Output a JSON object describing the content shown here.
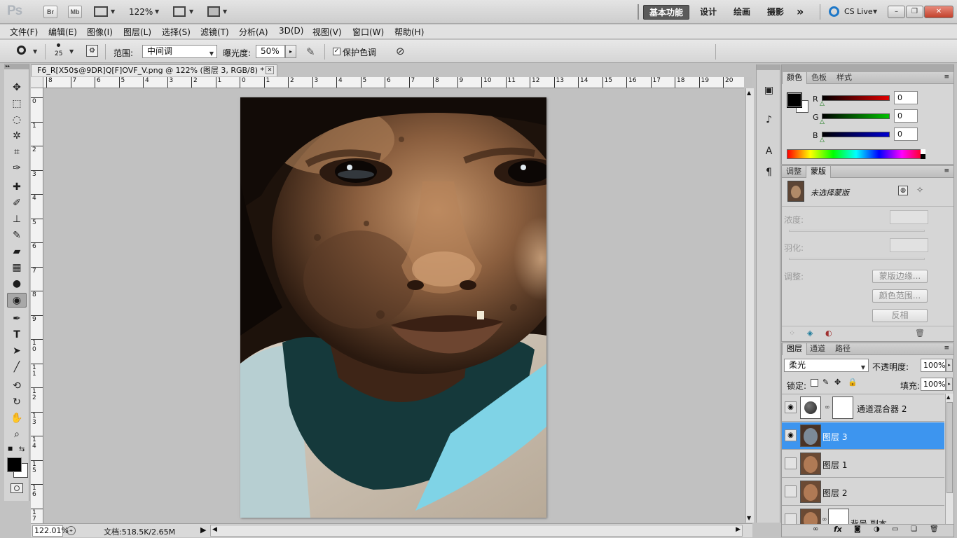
{
  "appbar": {
    "logo": "Ps",
    "bridge_btn": "Br",
    "minibridge_btn": "Mb",
    "zoom": "122%",
    "workspaces": [
      "基本功能",
      "设计",
      "绘画",
      "摄影"
    ],
    "more": "»",
    "cs_live": "CS Live",
    "window_controls": {
      "minimize": "–",
      "restore": "❐",
      "close": "✕"
    }
  },
  "menu": [
    "文件(F)",
    "编辑(E)",
    "图像(I)",
    "图层(L)",
    "选择(S)",
    "滤镜(T)",
    "分析(A)",
    "3D(D)",
    "视图(V)",
    "窗口(W)",
    "帮助(H)"
  ],
  "options": {
    "brush_size": "25",
    "range_label": "范围:",
    "range_value": "中间调",
    "exposure_label": "曝光度:",
    "exposure_value": "50%",
    "protect_tones_label": "保护色调",
    "protect_tones_checked": true
  },
  "document": {
    "tab_title": "F6_R[X50$@9DR]Q[F]OVF_V.png @ 122% (图层 3, RGB/8) *",
    "close": "✕",
    "ruler_h": [
      "8",
      "7",
      "6",
      "5",
      "4",
      "3",
      "2",
      "1",
      "0",
      "1",
      "2",
      "3",
      "4",
      "5",
      "6",
      "7",
      "8",
      "9",
      "10",
      "11",
      "12",
      "13",
      "14",
      "15",
      "16",
      "17",
      "18",
      "19",
      "20"
    ],
    "ruler_v": [
      "0",
      "1",
      "2",
      "3",
      "4",
      "5",
      "6",
      "7",
      "8",
      "9",
      "1\n0",
      "1\n1",
      "1\n2",
      "1\n3",
      "1\n4",
      "1\n5",
      "1\n6",
      "1\n7"
    ],
    "status_zoom": "122.01%",
    "status_doc": "文档:518.5K/2.65M"
  },
  "color_panel": {
    "tabs": [
      "颜色",
      "色板",
      "样式"
    ],
    "channels": [
      {
        "label": "R",
        "value": "0",
        "color": "#e00000"
      },
      {
        "label": "G",
        "value": "0",
        "color": "#00c000"
      },
      {
        "label": "B",
        "value": "0",
        "color": "#0000d0"
      }
    ],
    "foreground": "#000000",
    "background": "#ffffff"
  },
  "mask_panel": {
    "tabs": [
      "调整",
      "蒙版"
    ],
    "status": "未选择蒙版",
    "density_label": "浓度:",
    "feather_label": "羽化:",
    "refine_label": "调整:",
    "btn_mask_edge": "蒙版边缘...",
    "btn_color_range": "颜色范围...",
    "btn_invert": "反相"
  },
  "layers_panel": {
    "tabs": [
      "图层",
      "通道",
      "路径"
    ],
    "blend_mode": "柔光",
    "opacity_label": "不透明度:",
    "opacity_value": "100%",
    "lock_label": "锁定:",
    "fill_label": "填充:",
    "fill_value": "100%",
    "layers": [
      {
        "name": "通道混合器 2",
        "visible": true,
        "selected": false,
        "type": "adjustment"
      },
      {
        "name": "图层 3",
        "visible": true,
        "selected": true,
        "type": "pixel"
      },
      {
        "name": "图层 1",
        "visible": false,
        "selected": false,
        "type": "pixel"
      },
      {
        "name": "图层 2",
        "visible": false,
        "selected": false,
        "type": "pixel"
      },
      {
        "name": "背景 副本",
        "visible": false,
        "selected": false,
        "type": "masked"
      }
    ]
  }
}
